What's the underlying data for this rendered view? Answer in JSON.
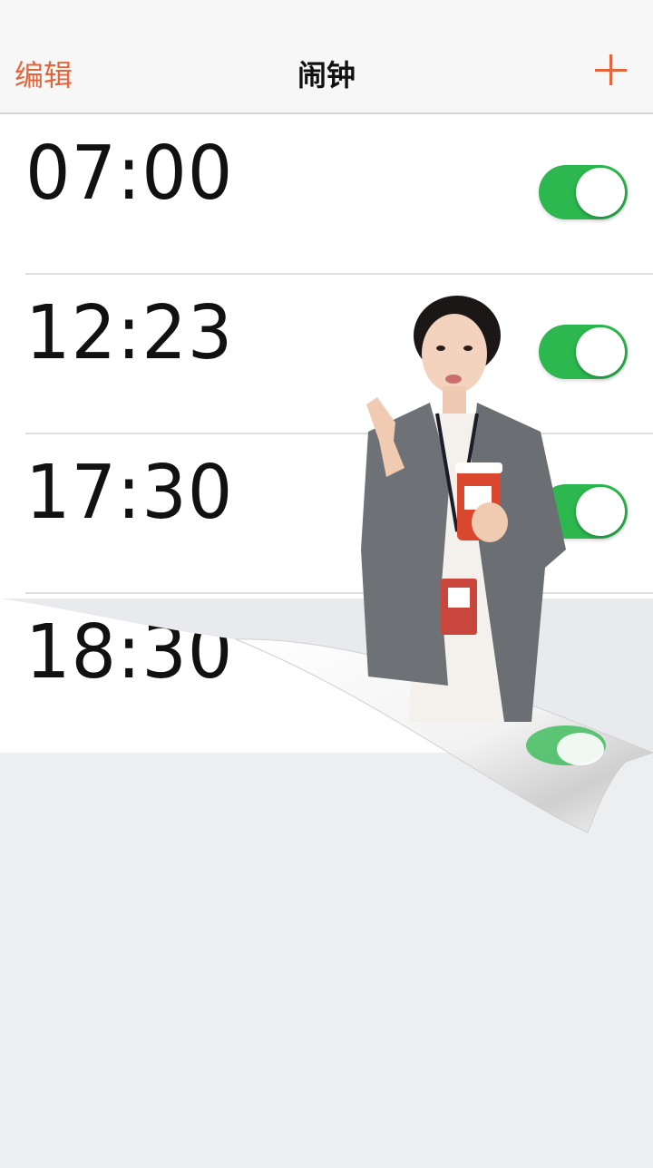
{
  "navbar": {
    "edit_label": "编辑",
    "title": "闹钟",
    "add_icon": "plus-icon"
  },
  "alarms": [
    {
      "time": "07:00",
      "enabled": true
    },
    {
      "time": "12:23",
      "enabled": true
    },
    {
      "time": "17:30",
      "enabled": true
    },
    {
      "time": "18:30",
      "enabled": true
    }
  ],
  "colors": {
    "accent": "#e4653b",
    "toggle_on": "#2db84f",
    "background": "#eceef0",
    "row": "#ffffff"
  }
}
